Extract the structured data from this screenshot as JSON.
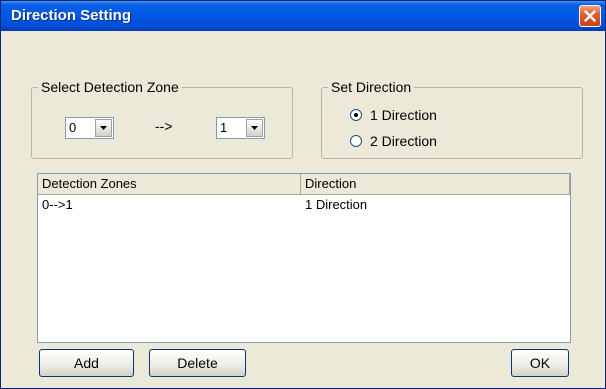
{
  "window": {
    "title": "Direction Setting",
    "close_icon": "close-icon"
  },
  "zone_group": {
    "legend": "Select Detection Zone",
    "from_value": "0",
    "arrow_label": "-->",
    "to_value": "1"
  },
  "direction_group": {
    "legend": "Set Direction",
    "options": [
      {
        "label": "1 Direction",
        "selected": true
      },
      {
        "label": "2 Direction",
        "selected": false
      }
    ]
  },
  "list": {
    "columns": [
      "Detection Zones",
      "Direction"
    ],
    "rows": [
      {
        "zone": "0-->1",
        "direction": "1 Direction"
      }
    ]
  },
  "buttons": {
    "add": "Add",
    "delete": "Delete",
    "ok": "OK"
  },
  "colors": {
    "titlebar": "#0058e6",
    "dialog_bg": "#ece9d8",
    "close_button": "#e05a2a"
  }
}
